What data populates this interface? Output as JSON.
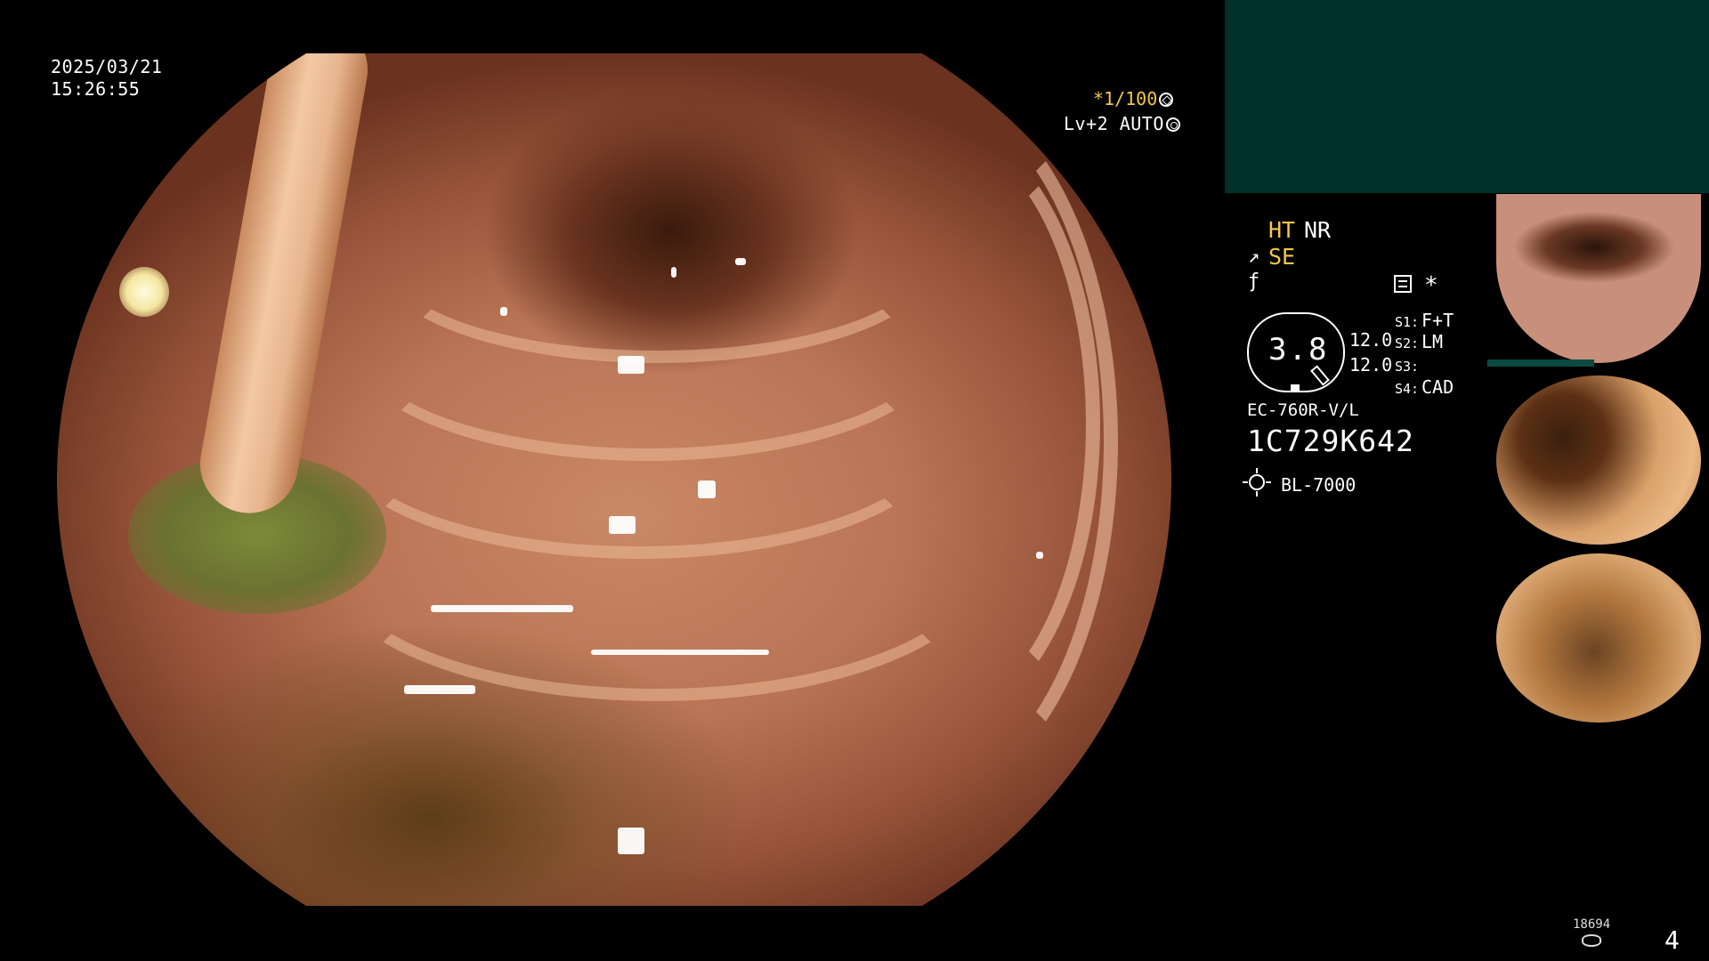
{
  "overlay": {
    "date": "2025/03/21",
    "time": "15:26:55",
    "shutter": "*1/100",
    "level": "Lv+2 AUTO"
  },
  "status": {
    "ht": "HT",
    "nr": "NR",
    "se": "SE",
    "asterisk": "*"
  },
  "gauge": {
    "value": "3.8",
    "val1": "12.0",
    "val2": "12.0"
  },
  "switches": [
    {
      "label": "S1:",
      "value": "F+T"
    },
    {
      "label": "S2:",
      "value": "LM"
    },
    {
      "label": "S3:",
      "value": ""
    },
    {
      "label": "S4:",
      "value": "CAD"
    }
  ],
  "device": {
    "model": "EC-760R-V/L",
    "serial": "1C729K642",
    "light_source": "BL-7000"
  },
  "footer": {
    "count": "18694",
    "page": "4"
  },
  "colors": {
    "accent_yellow": "#f3c64a",
    "panel_teal": "#00302a",
    "thumb_bar": "#0c4a40"
  },
  "icons": [
    "shutter-icon",
    "auto-icon",
    "se-icon",
    "f-icon",
    "menu-icon",
    "light-source-icon",
    "disk-icon"
  ]
}
